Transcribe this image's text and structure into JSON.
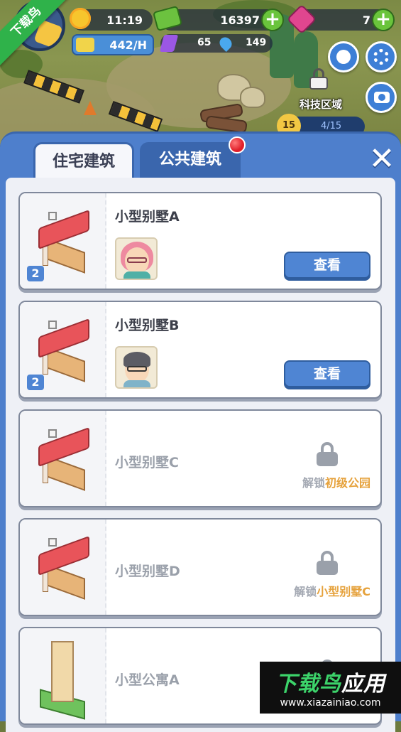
{
  "watermark": {
    "ribbon": "下载鸟",
    "brand_title_green": "下载鸟",
    "brand_title_white": "应用",
    "brand_url": "www.xiazainiao.com"
  },
  "hud": {
    "time": "11:19",
    "cash": "16397",
    "gems": "7",
    "income": "442/H",
    "crystals": "65",
    "water": "149",
    "zone_label": "科技区域",
    "level_badge": "15",
    "level_progress": "4/15"
  },
  "panel": {
    "tabs": [
      {
        "label": "住宅建筑",
        "active": true
      },
      {
        "label": "公共建筑",
        "active": false,
        "notification": true
      }
    ],
    "close_label": "✕",
    "buildings": [
      {
        "name": "小型别墅A",
        "count": "2",
        "resident": "pink-haired-girl",
        "button": "查看",
        "locked": false
      },
      {
        "name": "小型别墅B",
        "count": "2",
        "resident": "man-with-glasses",
        "button": "查看",
        "locked": false
      },
      {
        "name": "小型别墅C",
        "locked": true,
        "unlock_prefix": "解锁",
        "unlock_target": "初级公园"
      },
      {
        "name": "小型别墅D",
        "locked": true,
        "unlock_prefix": "解锁",
        "unlock_target": "小型别墅C"
      },
      {
        "name": "小型公寓A",
        "locked": true
      }
    ]
  },
  "colors": {
    "panel_blue": "#4e7fcc",
    "button_blue": "#4f85d3",
    "unlock_orange": "#e6a23c",
    "roof_red": "#e8545a"
  }
}
